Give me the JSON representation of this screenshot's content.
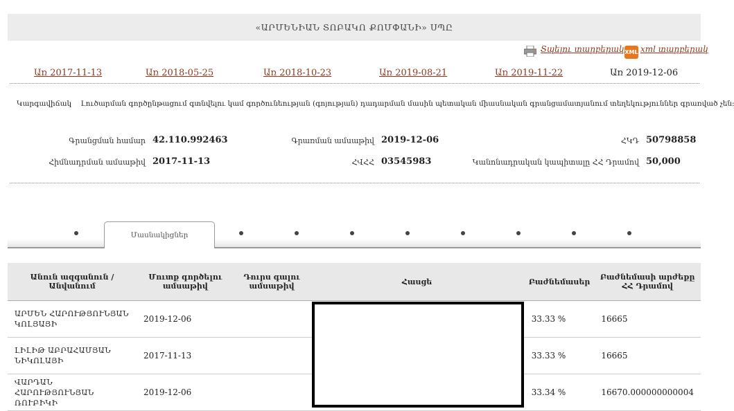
{
  "header": {
    "title": "«ԱՐՄԵՆԻԱՆ ՏՈԲԱԿՈ ՔՈՄՓԱՆԻ» ՍՊԸ"
  },
  "export": {
    "print_label": "Տպելու տարբերակ",
    "xml_label": "xml տարբերակ",
    "xml_icon_text": "XML"
  },
  "versions": [
    {
      "label": "Առ 2017-11-13"
    },
    {
      "label": "Առ 2018-05-25"
    },
    {
      "label": "Առ 2018-10-23"
    },
    {
      "label": "Առ 2019-08-21"
    },
    {
      "label": "Առ 2019-11-22"
    },
    {
      "label": "Առ 2019-12-06"
    }
  ],
  "status": {
    "label": "Կարգավիճակ",
    "text": "Լուծարման գործընթացում գտնվելու կամ գործունեության (գոյության) դադարման մասին պետական միասնական գրանցամատյանում տեղեկություններ գրառված չեն։"
  },
  "info": {
    "reg_number_label": "Գրանցման համար",
    "reg_number": "42.110.992463",
    "reg_date_label": "Գրառման ամսաթիվ",
    "reg_date": "2019-12-06",
    "tax_label": "ՀԿԴ",
    "tax": "50798858",
    "found_date_label": "Հիմնադրման ամսաթիվ",
    "found_date": "2017-11-13",
    "hvhh_label": "ՀՎՀՀ",
    "hvhh": "03545983",
    "capital_label": "Կանոնադրական կապիտալը ՀՀ Դրամով",
    "capital": "50,000"
  },
  "tabs": {
    "active": "Մասնակիցներ"
  },
  "table": {
    "headers": [
      "Անուն ազգանուն / Անվանում",
      "Մուտք գործելու ամսաթիվ",
      "Դուրս գալու ամսաթիվ",
      "Հասցե",
      "Բաժնեմասեր",
      "Բաժնեմասի արժեքը ՀՀ Դրամով"
    ],
    "rows": [
      {
        "name": "ԱՐՄԵՆ ՀԱՐՈՒԹՅՈՒՆՅԱՆ ԿՈԼՅԱՅԻ",
        "in": "2019-12-06",
        "out": "",
        "addr": "",
        "share": "33.33 %",
        "value": "16665"
      },
      {
        "name": "ԼԻԼԻԹ ԱԲՐԱՀԱՄՅԱՆ ՆԻԿՈԼԱՅԻ",
        "in": "2017-11-13",
        "out": "",
        "addr": "",
        "share": "33.33 %",
        "value": "16665"
      },
      {
        "name": "ՎԱՐԴԱՆ ՀԱՐՈՒԹՅՈՒՆՅԱՆ ՌՈՒԲԻԿԻ",
        "in": "2019-12-06",
        "out": "",
        "addr": "",
        "share": "33.34 %",
        "value": "16670.000000000004"
      }
    ]
  },
  "colors": {
    "link": "#8b3a1e",
    "header_bg": "#ececec",
    "xml_icon": "#e8761e"
  }
}
